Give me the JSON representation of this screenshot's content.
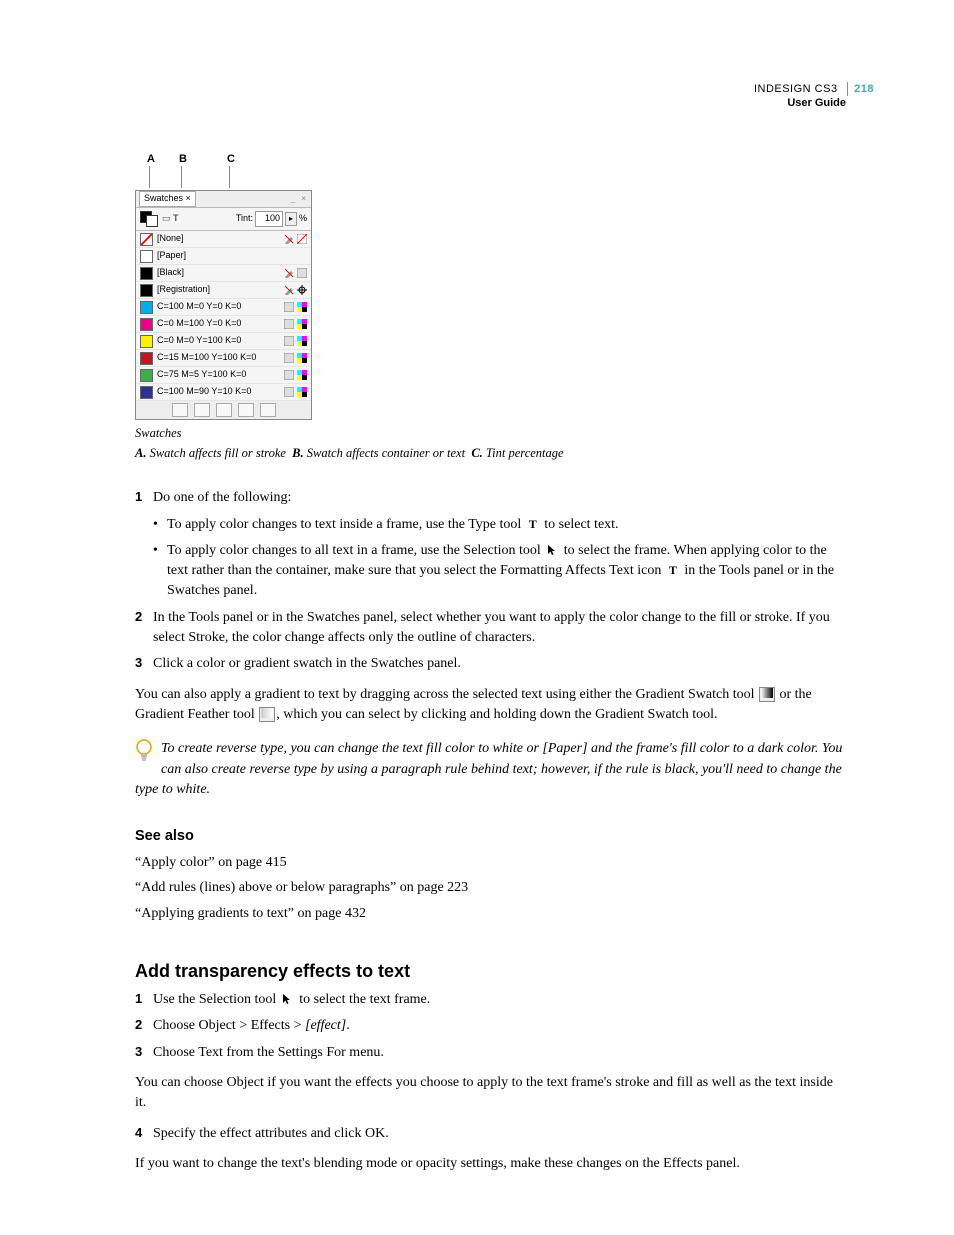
{
  "header": {
    "product": "INDESIGN CS3",
    "pagenum": "218",
    "subtitle": "User Guide"
  },
  "figure": {
    "callout_a": "A",
    "callout_b": "B",
    "callout_c": "C",
    "tab_name": "Swatches",
    "tint_label": "Tint:",
    "tint_value": "100",
    "tint_pct": "%",
    "rows": [
      {
        "label": "[None]",
        "color": "transparent",
        "none": true,
        "pencil": true,
        "noneicon": true
      },
      {
        "label": "[Paper]",
        "color": "#ffffff"
      },
      {
        "label": "[Black]",
        "color": "#000000",
        "pencil": true,
        "mode": true
      },
      {
        "label": "[Registration]",
        "color": "#000000",
        "pencil": true,
        "reg": true
      },
      {
        "label": "C=100 M=0 Y=0 K=0",
        "color": "#00aeef",
        "mode": true,
        "cmyk": true
      },
      {
        "label": "C=0 M=100 Y=0 K=0",
        "color": "#ec008c",
        "mode": true,
        "cmyk": true
      },
      {
        "label": "C=0 M=0 Y=100 K=0",
        "color": "#fff200",
        "mode": true,
        "cmyk": true
      },
      {
        "label": "C=15 M=100 Y=100 K=0",
        "color": "#c4161c",
        "mode": true,
        "cmyk": true
      },
      {
        "label": "C=75 M=5 Y=100 K=0",
        "color": "#3eae49",
        "mode": true,
        "cmyk": true
      },
      {
        "label": "C=100 M=90 Y=10 K=0",
        "color": "#2e3192",
        "mode": true,
        "cmyk": true
      }
    ]
  },
  "caption": "Swatches",
  "legend": {
    "a_key": "A.",
    "a_txt": "Swatch affects fill or stroke",
    "b_key": "B.",
    "b_txt": "Swatch affects container or text",
    "c_key": "C.",
    "c_txt": "Tint percentage"
  },
  "steps1": {
    "s1_num": "1",
    "s1_txt": "Do one of the following:",
    "b1_pre": "To apply color changes to text inside a frame, use the Type tool ",
    "b1_post": " to select text.",
    "b2_pre": "To apply color changes to all text in a frame, use the Selection tool ",
    "b2_mid": " to select the frame. When applying color to the text rather than the container, make sure that you select the Formatting Affects Text icon ",
    "b2_post": " in the Tools panel or in the Swatches panel.",
    "s2_num": "2",
    "s2_txt": "In the Tools panel or in the Swatches panel, select whether you want to apply the color change to the fill or stroke. If you select Stroke, the color change affects only the outline of characters.",
    "s3_num": "3",
    "s3_txt": "Click a color or gradient swatch in the Swatches panel."
  },
  "para_grad_pre": "You can also apply a gradient to text by dragging across the selected text using either the Gradient Swatch tool ",
  "para_grad_mid": " or the Gradient Feather tool ",
  "para_grad_post": ", which you can select by clicking and holding down the Gradient Swatch tool.",
  "tip_text": "To create reverse type, you can change the text fill color to white or [Paper] and the frame's fill color to a dark color. You can also create reverse type by using a paragraph rule behind text; however, if the rule is black, you'll need to change the type to white.",
  "seealso": {
    "heading": "See also",
    "links": [
      "“Apply color” on page 415",
      "“Add rules (lines) above or below paragraphs” on page 223",
      "“Applying gradients to text” on page 432"
    ]
  },
  "section2": {
    "heading": "Add transparency effects to text",
    "s1_num": "1",
    "s1_pre": "Use the Selection tool ",
    "s1_post": " to select the text frame.",
    "s2_num": "2",
    "s2_pre": "Choose Object > Effects > ",
    "s2_em": "[effect]",
    "s2_post": ".",
    "s3_num": "3",
    "s3_txt": "Choose Text from the Settings For menu.",
    "p1": "You can choose Object if you want the effects you choose to apply to the text frame's stroke and fill as well as the text inside it.",
    "s4_num": "4",
    "s4_txt": "Specify the effect attributes and click OK.",
    "p2": "If you want to change the text's blending mode or opacity settings, make these changes on the Effects panel."
  },
  "icons": {
    "type_T": "T",
    "arrow": "↖",
    "grad_box": " ",
    "grad_feather": " "
  }
}
